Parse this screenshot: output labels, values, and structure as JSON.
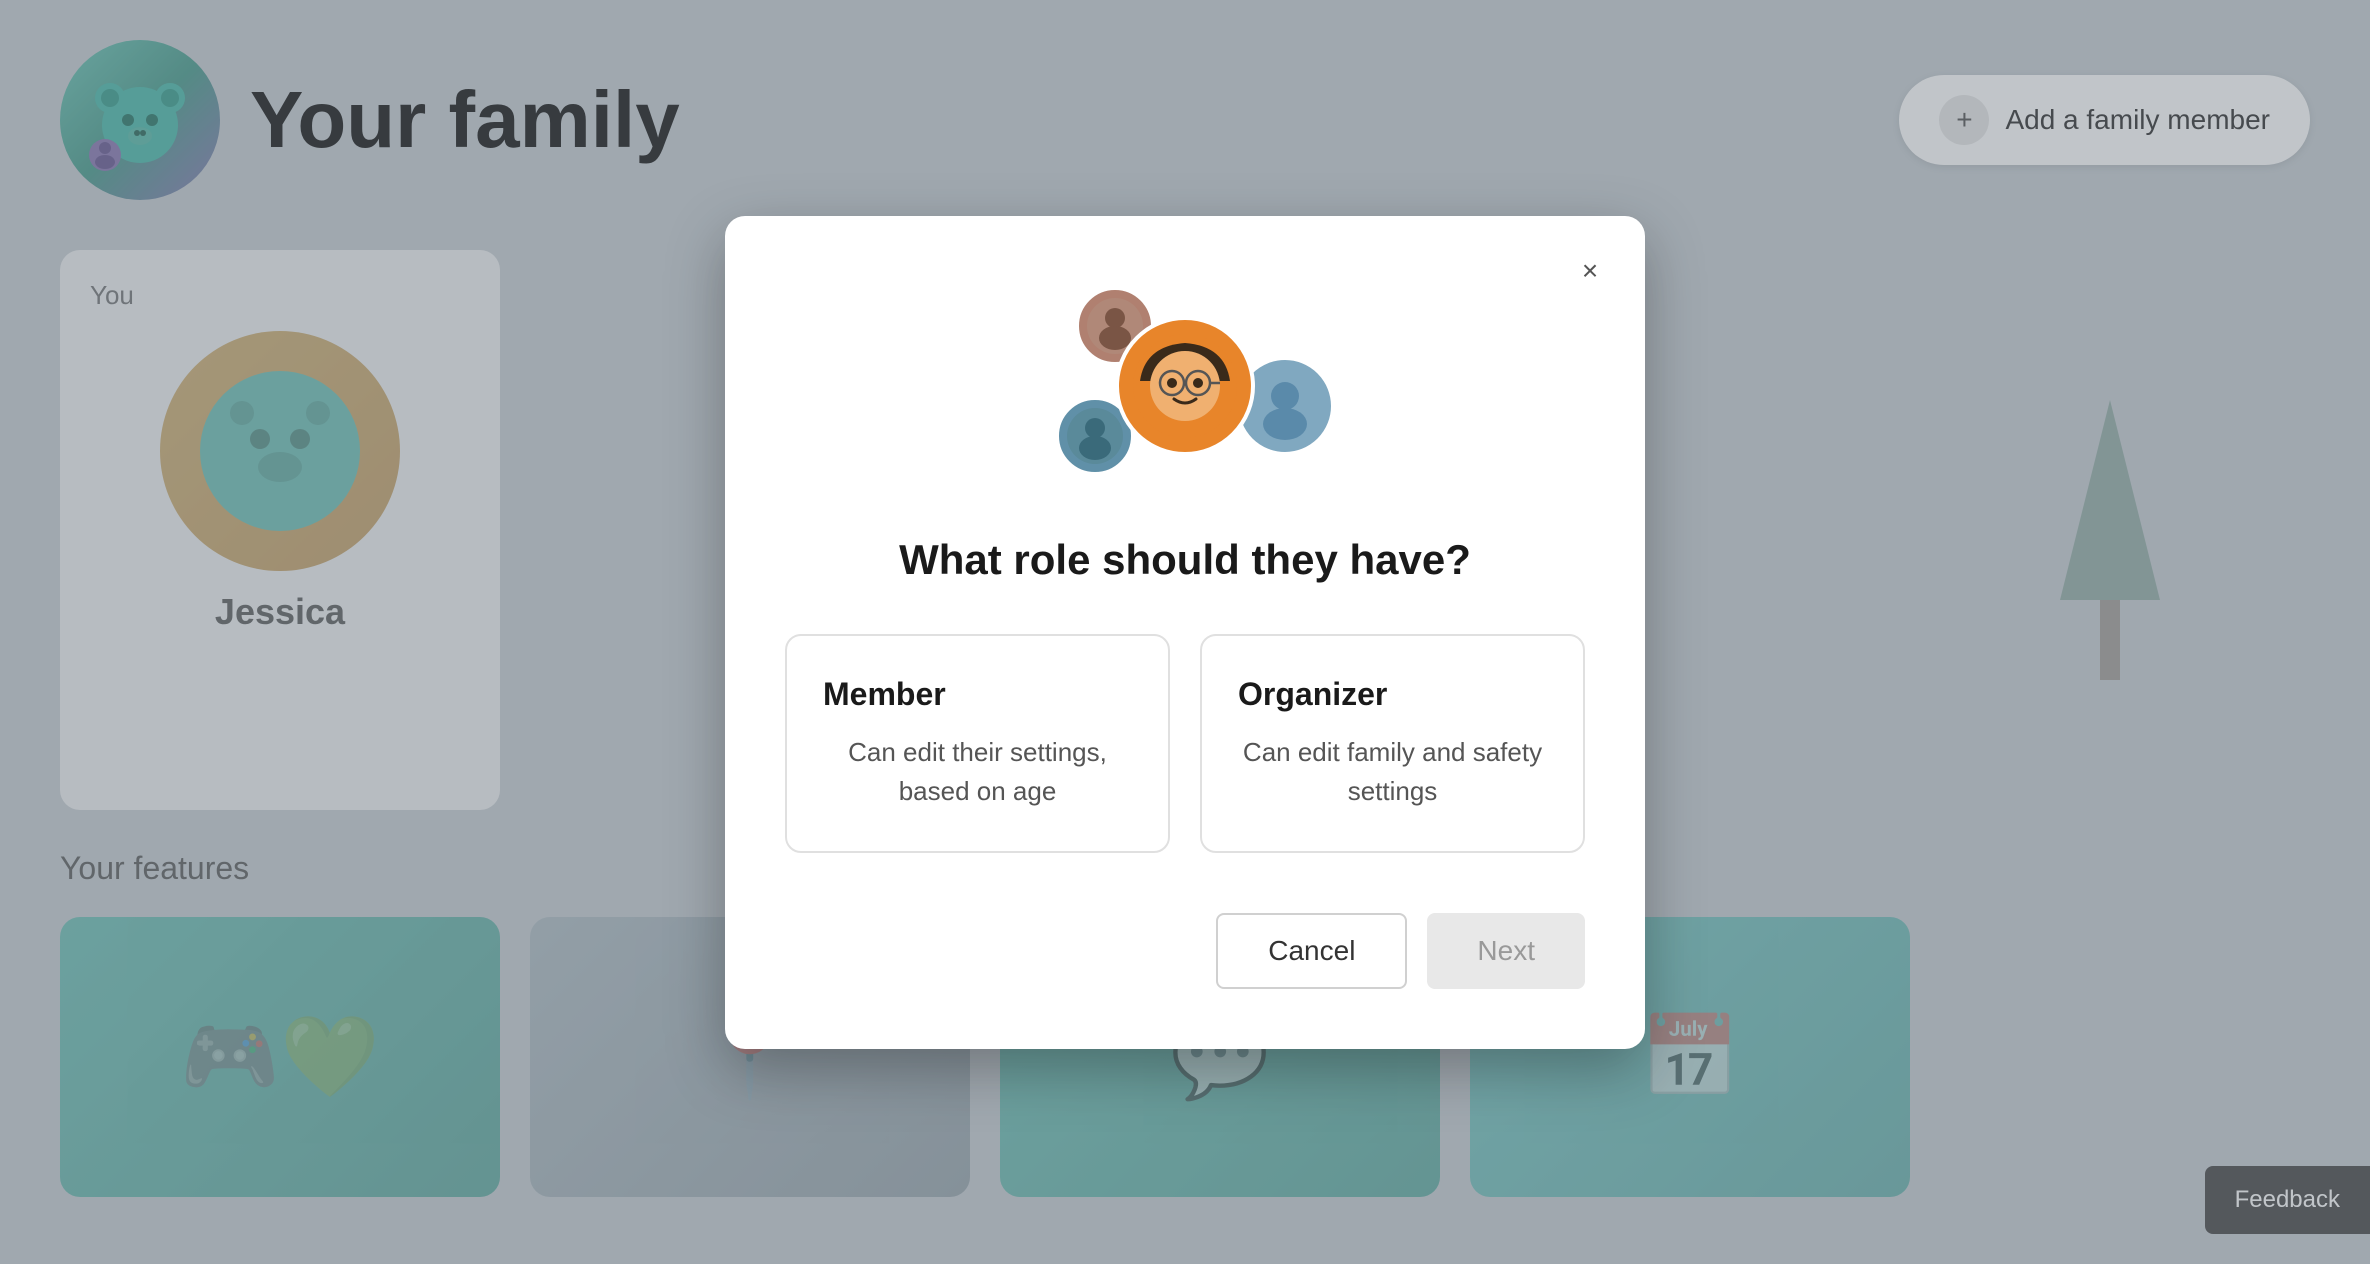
{
  "page": {
    "title": "Your family",
    "bg_color": "#c8cfd4"
  },
  "header": {
    "add_member_label": "Add a family member"
  },
  "user_card": {
    "label": "You",
    "name": "Jessica"
  },
  "features": {
    "title": "Your features"
  },
  "dialog": {
    "heading": "What role should they have?",
    "close_label": "×",
    "roles": [
      {
        "id": "member",
        "title": "Member",
        "description": "Can edit their settings, based on age"
      },
      {
        "id": "organizer",
        "title": "Organizer",
        "description": "Can edit family and safety settings"
      }
    ],
    "cancel_label": "Cancel",
    "next_label": "Next"
  },
  "feedback": {
    "label": "Feedback"
  }
}
